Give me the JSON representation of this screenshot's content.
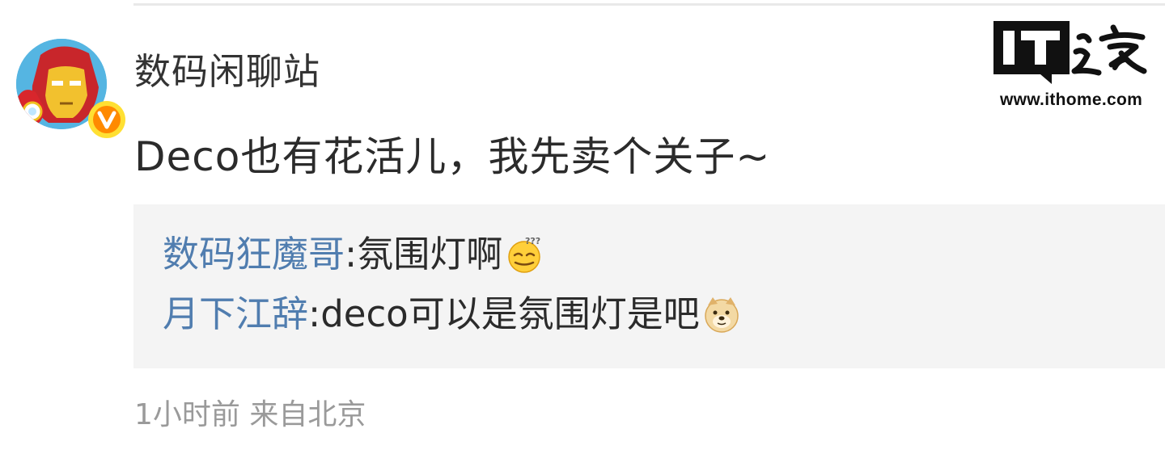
{
  "post": {
    "username": "数码闲聊站",
    "text": "Deco也有花活儿，我先卖个关子~",
    "meta": "1小时前 来自北京"
  },
  "comments": [
    {
      "author": "数码狂魔哥",
      "separator": ":",
      "text": "氛围灯啊",
      "emoji": "sleepy-face-emoji"
    },
    {
      "author": "月下江辞",
      "separator": ":",
      "text": "deco可以是氛围灯是吧",
      "emoji": "doge-emoji"
    }
  ],
  "watermark": {
    "logo_text": "IT之家",
    "url": "www.ithome.com"
  },
  "avatar": {
    "icon": "iron-man-avatar",
    "badge": "verified-v-badge"
  },
  "colors": {
    "commenter_name": "#507daf",
    "comment_bg": "#f4f4f4",
    "meta_text": "#9a9a9a",
    "badge_orange": "#ff8a00",
    "badge_yellow": "#ffd800"
  }
}
